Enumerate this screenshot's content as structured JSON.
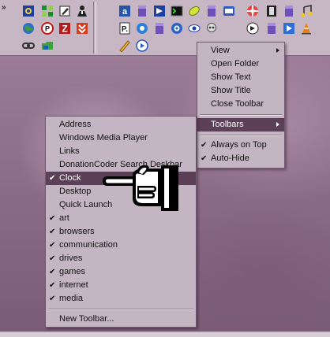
{
  "toolbar": {
    "overflow_glyph": "»",
    "icons": [
      "quickviewer-icon",
      "green-blocks-icon",
      "pencil-tools-icon",
      "agent-person-icon",
      "browser-icon",
      "notepad-icon",
      "explorer-icon",
      "terminal-icon",
      "leaf-icon",
      "photo-icon",
      "camera-icon",
      "film-icon",
      "music-notes-icon",
      "globe-icon",
      "no-sign-icon",
      "filezilla-icon",
      "compress-icon",
      "puzzle-icon",
      "chrome-icon",
      "camera-settings-icon",
      "eye-icon",
      "skull-icon",
      "media-player-icon",
      "vlc-cone-icon",
      "chain-link-icon",
      "green-folder-icon",
      "pencil-ruler-icon",
      "sync-icon"
    ]
  },
  "context_menu": {
    "items": [
      {
        "label": "View",
        "submenu": true
      },
      {
        "label": "Open Folder"
      },
      {
        "label": "Show Text"
      },
      {
        "label": "Show Title"
      },
      {
        "label": "Close Toolbar"
      },
      {
        "label": "Toolbars",
        "submenu": true,
        "highlighted": true
      },
      {
        "label": "Always on Top",
        "checked": true
      },
      {
        "label": "Auto-Hide",
        "checked": true
      }
    ]
  },
  "toolbars_submenu": {
    "items": [
      {
        "label": "Address"
      },
      {
        "label": "Windows Media Player"
      },
      {
        "label": "Links"
      },
      {
        "label": "DonationCoder Search Deskbar"
      },
      {
        "label": "Clock",
        "checked": true,
        "highlighted": true
      },
      {
        "label": "Desktop"
      },
      {
        "label": "Quick Launch"
      },
      {
        "label": "art",
        "checked": true
      },
      {
        "label": "browsers",
        "checked": true
      },
      {
        "label": "communication",
        "checked": true
      },
      {
        "label": "drives",
        "checked": true
      },
      {
        "label": "games",
        "checked": true
      },
      {
        "label": "internet",
        "checked": true
      },
      {
        "label": "media",
        "checked": true
      },
      {
        "label": "New Toolbar..."
      }
    ]
  },
  "check_glyph": "✔",
  "colors": {
    "menu_bg": "#c4b5c2",
    "highlight": "#5b4058",
    "toolbar_bg": "#c7b7c4"
  }
}
